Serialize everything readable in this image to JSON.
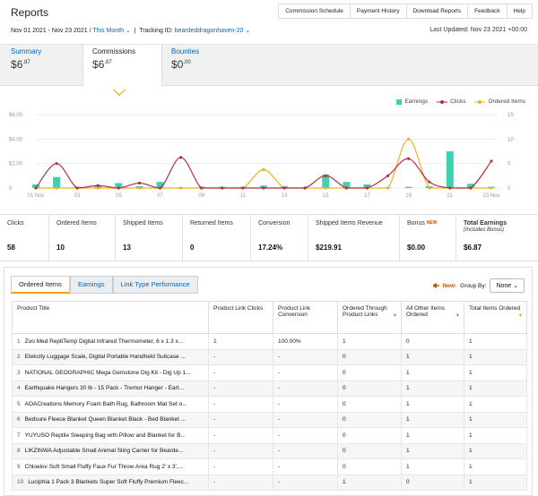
{
  "header": {
    "title": "Reports",
    "links": [
      "Commission Schedule",
      "Payment History",
      "Download Reports",
      "Feedback",
      "Help"
    ],
    "date_range": "Nov 01 2021 - Nov 23 2021",
    "range_select": "This Month",
    "tracking_label": "Tracking ID:",
    "tracking_id": "beardeddragonhaven-20",
    "last_updated": "Last Updated: Nov 23 2021 +00:00"
  },
  "tabs": [
    {
      "label": "Summary",
      "currency": "$",
      "value": "6",
      "cents": ".87"
    },
    {
      "label": "Commissions",
      "currency": "$",
      "value": "6",
      "cents": ".87"
    },
    {
      "label": "Bounties",
      "currency": "$",
      "value": "0",
      "cents": ".00"
    }
  ],
  "chart_data": {
    "type": "line",
    "x_ticks": [
      "01 Nov",
      "03",
      "05",
      "07",
      "09",
      "11",
      "13",
      "15",
      "17",
      "19",
      "21",
      "23 Nov"
    ],
    "y_left_ticks": [
      "$6.00",
      "$4.00",
      "$2.00",
      "0"
    ],
    "y_left_range": [
      0,
      6
    ],
    "y_right_ticks": [
      "15",
      "10",
      "5",
      "0"
    ],
    "y_right_range": [
      0,
      15
    ],
    "legend": [
      "Earnings",
      "Clicks",
      "Ordered Items"
    ],
    "colors": {
      "earnings": "#3fd1b2",
      "clicks": "#b2323c",
      "ordered": "#f2b01e"
    },
    "series": [
      {
        "name": "Earnings",
        "axis": "left",
        "values": [
          0.3,
          0.9,
          0.1,
          0.2,
          0.4,
          0.15,
          0.5,
          0.05,
          0.1,
          0.1,
          0.1,
          0.2,
          0.15,
          0.05,
          1.1,
          0.5,
          0.3,
          0.05,
          0.1,
          0.15,
          3.0,
          0.35,
          0.1
        ]
      },
      {
        "name": "Clicks",
        "axis": "left",
        "values": [
          0.0,
          2.0,
          0.0,
          0.2,
          0.0,
          0.4,
          0.0,
          2.5,
          0.0,
          0.0,
          0.0,
          0.0,
          0.0,
          0.0,
          1.0,
          0.0,
          0.0,
          1.0,
          2.4,
          0.5,
          0.0,
          0.0,
          2.2
        ]
      },
      {
        "name": "Ordered Items",
        "axis": "left",
        "values": [
          0.0,
          0.0,
          0.0,
          0.0,
          0.0,
          0.0,
          0.0,
          0.0,
          0.0,
          0.0,
          0.0,
          1.5,
          0.0,
          0.0,
          0.0,
          0.0,
          0.0,
          0.0,
          4.0,
          0.0,
          0.0,
          0.0,
          0.0
        ]
      }
    ]
  },
  "stats": [
    {
      "label": "Clicks",
      "value": "58"
    },
    {
      "label": "Ordered Items",
      "value": "10"
    },
    {
      "label": "Shipped Items",
      "value": "13"
    },
    {
      "label": "Returned Items",
      "value": "0"
    },
    {
      "label": "Conversion",
      "value": "17.24%"
    },
    {
      "label": "Shipped Items Revenue",
      "value": "$219.91"
    },
    {
      "label": "Bonus",
      "badge": "NEW",
      "value": "$0.00"
    },
    {
      "label": "Total Earnings",
      "sublabel": "(Includes Bonus)",
      "value": "$6.87"
    }
  ],
  "subtabs": [
    "Ordered Items",
    "Earnings",
    "Link Type Performance"
  ],
  "groupby": {
    "new": "New:",
    "label": "Group By:",
    "value": "None"
  },
  "table": {
    "headers": [
      "Product Title",
      "Product Link Clicks",
      "Product Link Conversion",
      "Ordered Through Product Links",
      "All Other Items Ordered",
      "Total Items Ordered"
    ],
    "rows": [
      {
        "n": "1",
        "title": "Zoo Med ReptiTemp Digital Infrared Thermometer, 6 x 1.3 x...",
        "clicks": "1",
        "conv": "100.00%",
        "through": "1",
        "other": "0",
        "total": "1"
      },
      {
        "n": "2",
        "title": "Etekcity Luggage Scale, Digital Portable Handheld Suitcase ...",
        "clicks": "-",
        "conv": "-",
        "through": "0",
        "other": "1",
        "total": "1"
      },
      {
        "n": "3",
        "title": "NATIONAL GEOGRAPHIC Mega Gemstone Dig Kit - Dig Up 1...",
        "clicks": "-",
        "conv": "-",
        "through": "0",
        "other": "1",
        "total": "1"
      },
      {
        "n": "4",
        "title": "Earthquake Hangers 30 lb - 15 Pack - Tremor Hanger - Eart...",
        "clicks": "-",
        "conv": "-",
        "through": "0",
        "other": "1",
        "total": "1"
      },
      {
        "n": "5",
        "title": "AOACreations Memory Foam Bath Rug, Bathroom Mat Set o...",
        "clicks": "-",
        "conv": "-",
        "through": "0",
        "other": "1",
        "total": "1"
      },
      {
        "n": "6",
        "title": "Bedsure Fleece Blanket Queen Blanket Black - Bed Blanket ...",
        "clicks": "-",
        "conv": "-",
        "through": "0",
        "other": "1",
        "total": "1"
      },
      {
        "n": "7",
        "title": "YUYUSO Reptile Sleeping Bag with Pillow and Blanket for B...",
        "clicks": "-",
        "conv": "-",
        "through": "0",
        "other": "1",
        "total": "1"
      },
      {
        "n": "8",
        "title": "LIKZINWA Adjustable Small Animal Sling Carrier for Bearde...",
        "clicks": "-",
        "conv": "-",
        "through": "0",
        "other": "1",
        "total": "1"
      },
      {
        "n": "9",
        "title": "Chloelov Soft Small Fluffy Faux Fur Throw Area Rug 2' x 3',...",
        "clicks": "-",
        "conv": "-",
        "through": "0",
        "other": "1",
        "total": "1"
      },
      {
        "n": "10",
        "title": "Luciphia 1 Pack 3 Blankets Super Soft Fluffy Premium Fleec...",
        "clicks": "-",
        "conv": "-",
        "through": "1",
        "other": "0",
        "total": "1"
      }
    ]
  }
}
